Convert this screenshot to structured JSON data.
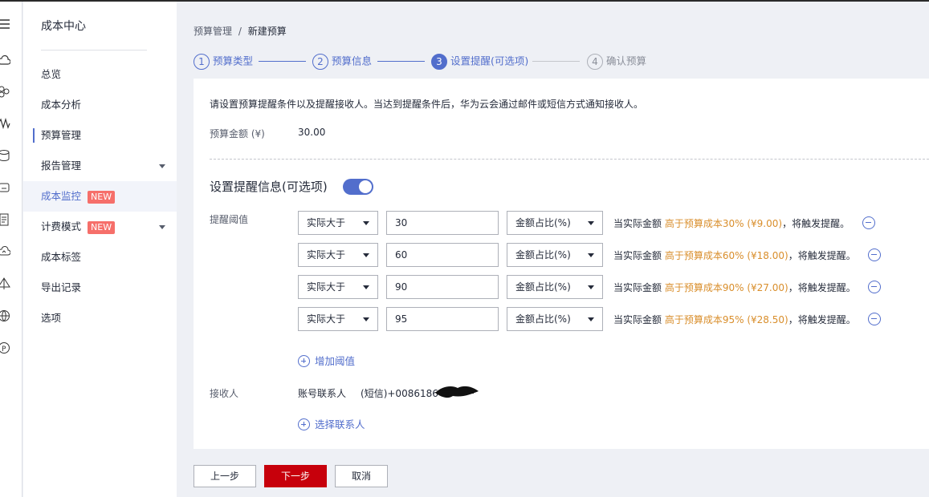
{
  "nav": {
    "title": "成本中心",
    "items": [
      {
        "label": "总览"
      },
      {
        "label": "成本分析"
      },
      {
        "label": "预算管理"
      },
      {
        "label": "报告管理"
      },
      {
        "label": "成本监控",
        "badge": "NEW"
      },
      {
        "label": "计费模式",
        "badge": "NEW"
      },
      {
        "label": "成本标签"
      },
      {
        "label": "导出记录"
      },
      {
        "label": "选项"
      }
    ]
  },
  "breadcrumb": {
    "parent": "预算管理",
    "separator": "/",
    "current": "新建预算"
  },
  "steps": [
    {
      "num": "1",
      "label": "预算类型",
      "state": "done"
    },
    {
      "num": "2",
      "label": "预算信息",
      "state": "done"
    },
    {
      "num": "3",
      "label": "设置提醒(可选项)",
      "state": "current"
    },
    {
      "num": "4",
      "label": "确认预算",
      "state": "todo"
    }
  ],
  "form": {
    "notice": "请设置预算提醒条件以及提醒接收人。当达到提醒条件后，华为云会通过邮件或短信方式通知接收人。",
    "amount_label": "预算金额 (¥)",
    "amount_value": "30.00",
    "section_title": "设置提醒信息(可选项)",
    "toggle_on": true,
    "threshold_label": "提醒阈值",
    "thresholds": [
      {
        "condition": "实际大于",
        "value": "30",
        "unit": "金额占比(%)",
        "desc_prefix": "当实际金额",
        "desc_highlight": "高于预算成本30% (¥9.00)",
        "desc_suffix": "，将触发提醒。"
      },
      {
        "condition": "实际大于",
        "value": "60",
        "unit": "金额占比(%)",
        "desc_prefix": "当实际金额",
        "desc_highlight": "高于预算成本60% (¥18.00)",
        "desc_suffix": "，将触发提醒。"
      },
      {
        "condition": "实际大于",
        "value": "90",
        "unit": "金额占比(%)",
        "desc_prefix": "当实际金额",
        "desc_highlight": "高于预算成本90% (¥27.00)",
        "desc_suffix": "，将触发提醒。"
      },
      {
        "condition": "实际大于",
        "value": "95",
        "unit": "金额占比(%)",
        "desc_prefix": "当实际金额",
        "desc_highlight": "高于预算成本95% (¥28.50)",
        "desc_suffix": "，将触发提醒。"
      }
    ],
    "add_threshold_label": "增加阈值",
    "recipient_label": "接收人",
    "recipient_name": "账号联系人",
    "recipient_phone": "(短信)+0086186****",
    "select_contact_label": "选择联系人"
  },
  "footer": {
    "prev": "上一步",
    "next": "下一步",
    "cancel": "取消"
  },
  "colors": {
    "accent": "#526ecc",
    "primary_button": "#c7000b",
    "highlight": "#d98e2b",
    "badge": "#f66f6a"
  }
}
